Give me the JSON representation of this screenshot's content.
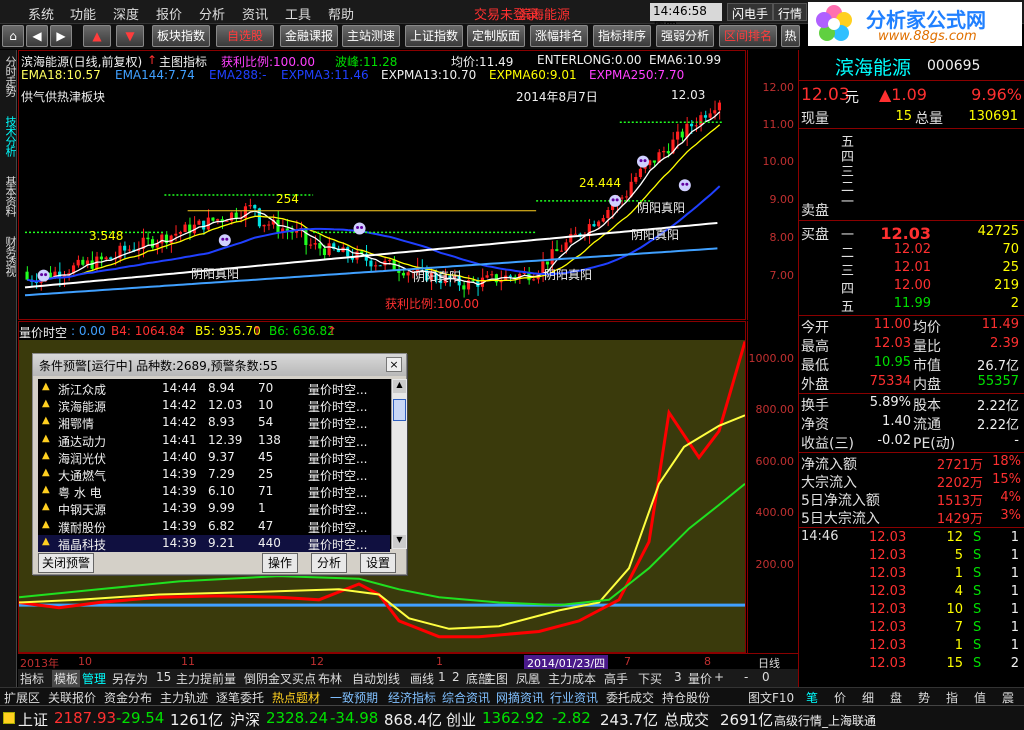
{
  "menu": [
    "系统",
    "功能",
    "深度",
    "报价",
    "分析",
    "资讯",
    "工具",
    "帮助"
  ],
  "notice": [
    "交易未登录",
    "滨海能源"
  ],
  "clock": "14:46:58 周四",
  "sys_buttons": [
    "闪电手",
    "行情",
    "资"
  ],
  "toolbar": [
    "板块指数",
    "自选股",
    "金融课报",
    "主站测速",
    "上证指数",
    "定制版面",
    "涨幅排名",
    "指标排序",
    "强弱分析",
    "区间排名",
    "热点板"
  ],
  "logo": {
    "title": "分析家公式网",
    "url": "www.88gs.com"
  },
  "left_tabs": [
    "分时走势",
    "技术分析",
    "基本资料",
    "财务透视"
  ],
  "kchart": {
    "title": "滨海能源(日线,前复权)",
    "main_indicator": "主图指标",
    "profit_ratio": "获利比例:100.00",
    "wave": "波峰:11.28",
    "avg_price": "均价:11.49",
    "enterlong": "ENTERLONG:0.00",
    "ema6": "EMA6:10.99",
    "ema18": "EMA18:10.57",
    "ema144": "EMA144:7.74",
    "ema288": "EMA288:-",
    "expma3": "EXPMA3:11.46",
    "expma13": "EXPMA13:10.70",
    "expma60": "EXPMA60:9.01",
    "expma250": "EXPMA250:7.70",
    "sector": "供气供热津板块",
    "date": "2014年8月7日",
    "high_label": "12.03",
    "label_24444": "24.444",
    "label_254": "254",
    "label_3548": "3.548",
    "bottom_profit": "获利比例:100.00",
    "yin_yang_1": "阴阳真阳",
    "yin_yang_2": "阴阳真阳",
    "yin_yang_3": "阴阳真阳",
    "yin_yang_4": "阴阳真阳",
    "yin_yang_5": "阴阳真阳",
    "yaxis": [
      "12.00",
      "11.00",
      "10.00",
      "9.00",
      "8.00",
      "7.00"
    ]
  },
  "volume": {
    "title": "量价时空",
    "v0": ": 0.00",
    "b4": "B4: 1064.84",
    "b5": "B5: 935.70",
    "b6": "B6: 636.82",
    "yaxis": [
      "1000.00",
      "800.00",
      "600.00",
      "400.00",
      "200.00"
    ]
  },
  "dialog": {
    "title": "条件预警[运行中] 品种数:2689,预警条数:55",
    "rows": [
      {
        "name": "浙江众成",
        "time": "14:44",
        "price": "8.94",
        "n": "70",
        "cond": "量价时空..."
      },
      {
        "name": "滨海能源",
        "time": "14:42",
        "price": "12.03",
        "n": "10",
        "cond": "量价时空..."
      },
      {
        "name": "湘鄂情",
        "time": "14:42",
        "price": "8.93",
        "n": "54",
        "cond": "量价时空..."
      },
      {
        "name": "通达动力",
        "time": "14:41",
        "price": "12.39",
        "n": "138",
        "cond": "量价时空..."
      },
      {
        "name": "海润光伏",
        "time": "14:40",
        "price": "9.37",
        "n": "45",
        "cond": "量价时空..."
      },
      {
        "name": "大通燃气",
        "time": "14:39",
        "price": "7.29",
        "n": "25",
        "cond": "量价时空..."
      },
      {
        "name": "粤 水 电",
        "time": "14:39",
        "price": "6.10",
        "n": "71",
        "cond": "量价时空..."
      },
      {
        "name": "中钢天源",
        "time": "14:39",
        "price": "9.99",
        "n": "1",
        "cond": "量价时空..."
      },
      {
        "name": "濮耐股份",
        "time": "14:39",
        "price": "6.82",
        "n": "47",
        "cond": "量价时空..."
      },
      {
        "name": "福晶科技",
        "time": "14:39",
        "price": "9.21",
        "n": "440",
        "cond": "量价时空..."
      }
    ],
    "buttons": [
      "关闭预警",
      "操作",
      "分析",
      "设置"
    ]
  },
  "timeaxis": {
    "labels": [
      "2013年",
      "10",
      "11",
      "12",
      "1",
      "2014/01/23/四",
      "7",
      "8"
    ],
    "right": "日线"
  },
  "tabs": [
    "指标",
    "模板",
    "管理",
    "另存为",
    "15",
    "主力提前量",
    "倒阴",
    "金叉买点",
    "布林",
    "自动划线",
    "画线",
    "1",
    "2",
    "底部",
    "主图",
    "凤凰",
    "主力成本",
    "高手",
    "下买",
    "3",
    "量价",
    "+",
    "-",
    "0"
  ],
  "funcs": [
    "扩展区",
    "关联报价",
    "资金分布",
    "主力轨迹",
    "逐笔委托",
    "热点题材",
    "一致预期",
    "经济指标",
    "综合资讯",
    "网摘资讯",
    "行业资讯",
    "委托成交",
    "持仓股份",
    "图文F10"
  ],
  "stock": {
    "name": "滨海能源",
    "code": "000695",
    "price": "12.03",
    "unit": "元",
    "change": "▲1.09",
    "pct": "9.96%",
    "now_label": "现量",
    "now_val": "15",
    "total_label": "总量",
    "total_val": "130691",
    "sell_side": "卖盘",
    "buy_side": "买盘",
    "sell_levels": [
      "五",
      "四",
      "三",
      "二",
      "一"
    ],
    "buy_levels": [
      {
        "lv": "一",
        "price": "12.03",
        "vol": "42725"
      },
      {
        "lv": "二",
        "price": "12.02",
        "vol": "70"
      },
      {
        "lv": "三",
        "price": "12.01",
        "vol": "25"
      },
      {
        "lv": "四",
        "price": "12.00",
        "vol": "219"
      },
      {
        "lv": "五",
        "price": "11.99",
        "vol": "2"
      }
    ],
    "stats": [
      {
        "l1": "今开",
        "v1": "11.00",
        "l2": "均价",
        "v2": "11.49"
      },
      {
        "l1": "最高",
        "v1": "12.03",
        "l2": "量比",
        "v2": "2.39"
      },
      {
        "l1": "最低",
        "v1": "10.95",
        "l2": "市值",
        "v2": "26.7亿"
      },
      {
        "l1": "外盘",
        "v1": "75334",
        "l2": "内盘",
        "v2": "55357"
      }
    ],
    "stats2": [
      {
        "l1": "换手",
        "v1": "5.89%",
        "l2": "股本",
        "v2": "2.22亿"
      },
      {
        "l1": "净资",
        "v1": "1.40",
        "l2": "流通",
        "v2": "2.22亿"
      },
      {
        "l1": "收益(三)",
        "v1": "-0.02",
        "l2": "PE(动)",
        "v2": "-"
      }
    ],
    "flows": [
      {
        "l": "净流入额",
        "v": "2721万",
        "p": "18%"
      },
      {
        "l": "大宗流入",
        "v": "2202万",
        "p": "15%"
      },
      {
        "l": "5日净流入额",
        "v": "1513万",
        "p": "4%"
      },
      {
        "l": "5日大宗流入",
        "v": "1429万",
        "p": "3%"
      }
    ],
    "ticks_time": "14:46",
    "ticks": [
      {
        "p": "12.03",
        "v": "12",
        "s": "S",
        "n": "1"
      },
      {
        "p": "12.03",
        "v": "5",
        "s": "S",
        "n": "1"
      },
      {
        "p": "12.03",
        "v": "1",
        "s": "S",
        "n": "1"
      },
      {
        "p": "12.03",
        "v": "4",
        "s": "S",
        "n": "1"
      },
      {
        "p": "12.03",
        "v": "10",
        "s": "S",
        "n": "1"
      },
      {
        "p": "12.03",
        "v": "7",
        "s": "S",
        "n": "1"
      },
      {
        "p": "12.03",
        "v": "1",
        "s": "S",
        "n": "1"
      },
      {
        "p": "12.03",
        "v": "15",
        "s": "S",
        "n": "2"
      }
    ]
  },
  "bottom_tabs": [
    "笔",
    "价",
    "细",
    "盘",
    "势",
    "指",
    "值",
    "震"
  ],
  "status": {
    "sh_label": "上证",
    "sh_val": "2187.93",
    "sh_chg": "-29.54",
    "sh_amt": "1261亿",
    "hs_label": "沪深",
    "hs_val": "2328.24",
    "hs_chg": "-34.98",
    "hs_amt": "868.4亿",
    "cy_label": "创业",
    "cy_val": "1362.92",
    "cy_chg": "-2.82",
    "cy_amt": "243.7亿",
    "total_label": "总成交",
    "total_val": "2691亿",
    "feed": "高级行情_上海联通"
  },
  "colors": {
    "up": "#ff3030",
    "down": "#00e000",
    "ema_white": "#ffffff",
    "ema_yellow": "#ffff00",
    "ema_blue": "#2040ff",
    "vol_red": "#ff0000",
    "vol_yellow": "#ffff40",
    "vol_green": "#20e020",
    "baseline": "#40a0ff"
  }
}
